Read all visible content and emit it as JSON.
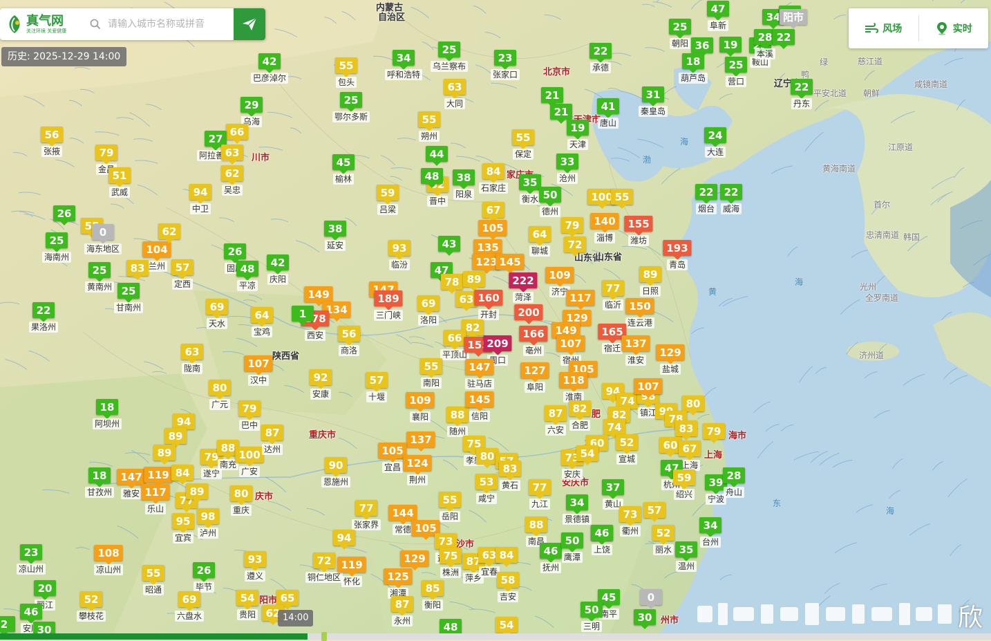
{
  "search": {
    "placeholder": "请输入城市名称或拼音"
  },
  "logo": {
    "brand": "真气网",
    "slogan": "关注环境 关爱健康"
  },
  "history": {
    "label": "历史: 2025-12-29 14:00"
  },
  "toolbar": {
    "wind_label": "风场",
    "realtime_label": "实时"
  },
  "timeline": {
    "current_label": "14:00",
    "progress": 0.31
  },
  "watermark": {
    "text": "欣"
  },
  "colors": {
    "good": "#3dbb1e",
    "moderate": "#e8c41c",
    "light": "#f5a017",
    "medium": "#ee5a3c",
    "heavy": "#c4245a",
    "none": "#b8b8b8",
    "brand": "#2e9a3c"
  },
  "map_labels": [
    {
      "text": "内蒙古",
      "kind": "province"
    },
    {
      "text": "自治区",
      "kind": "province"
    },
    {
      "text": "北京市",
      "kind": "city"
    },
    {
      "text": "天津市",
      "kind": "city"
    },
    {
      "text": "家庄市",
      "kind": "city"
    },
    {
      "text": "辽宁省",
      "kind": "province"
    },
    {
      "text": "山东省",
      "kind": "province"
    },
    {
      "text": "陕西省",
      "kind": "province"
    },
    {
      "text": "重庆市",
      "kind": "city"
    },
    {
      "text": "渤",
      "kind": "sea"
    },
    {
      "text": "海",
      "kind": "sea"
    },
    {
      "text": "黄",
      "kind": "sea"
    },
    {
      "text": "海",
      "kind": "sea"
    },
    {
      "text": "东",
      "kind": "sea"
    },
    {
      "text": "海",
      "kind": "sea"
    },
    {
      "text": "江原道",
      "kind": "foreign"
    },
    {
      "text": "黄海南道",
      "kind": "foreign"
    },
    {
      "text": "首尔",
      "kind": "foreign"
    },
    {
      "text": "忠清南道",
      "kind": "foreign"
    },
    {
      "text": "韩国",
      "kind": "foreign"
    },
    {
      "text": "光州",
      "kind": "foreign"
    },
    {
      "text": "全罗南道",
      "kind": "foreign"
    },
    {
      "text": "济州道",
      "kind": "foreign"
    },
    {
      "text": "慈江道",
      "kind": "foreign"
    },
    {
      "text": "咸镜南道",
      "kind": "foreign"
    },
    {
      "text": "平安北道",
      "kind": "foreign"
    },
    {
      "text": "朝鲜",
      "kind": "foreign"
    },
    {
      "text": "鸭",
      "kind": "foreign"
    },
    {
      "text": "绿",
      "kind": "foreign"
    },
    {
      "text": "安庆市",
      "kind": "city"
    },
    {
      "text": "上海",
      "kind": "city"
    },
    {
      "text": "海市",
      "kind": "city"
    },
    {
      "text": "川市",
      "kind": "city"
    },
    {
      "text": "庆市",
      "kind": "city"
    },
    {
      "text": "阳市",
      "kind": "city"
    },
    {
      "text": "沙市",
      "kind": "city"
    },
    {
      "text": "州市",
      "kind": "city"
    },
    {
      "text": "山东省",
      "kind": "province"
    },
    {
      "text": "肥",
      "kind": "city"
    }
  ],
  "stations": [
    {
      "v": "47",
      "c": "阜新"
    },
    {
      "v": "34",
      "c": ""
    },
    {
      "v": "41",
      "c": ""
    },
    {
      "v": "阳市",
      "c": ""
    },
    {
      "v": "25",
      "c": "朝阳"
    },
    {
      "v": "36",
      "c": ""
    },
    {
      "v": "19",
      "c": ""
    },
    {
      "v": "23",
      "c": "鞍山"
    },
    {
      "v": "28",
      "c": "本溪"
    },
    {
      "v": "22",
      "c": ""
    },
    {
      "v": "18",
      "c": "葫芦岛"
    },
    {
      "v": "25",
      "c": "营口"
    },
    {
      "v": "22",
      "c": "丹东"
    },
    {
      "v": "31",
      "c": "秦皇岛"
    },
    {
      "v": "24",
      "c": "大连"
    },
    {
      "v": "22",
      "c": "烟台"
    },
    {
      "v": "22",
      "c": "威海"
    },
    {
      "v": "22",
      "c": "承德"
    },
    {
      "v": "23",
      "c": "张家口"
    },
    {
      "v": "21",
      "c": ""
    },
    {
      "v": "21",
      "c": ""
    },
    {
      "v": "19",
      "c": "天津"
    },
    {
      "v": "41",
      "c": "唐山"
    },
    {
      "v": "55",
      "c": "保定"
    },
    {
      "v": "33",
      "c": "沧州"
    },
    {
      "v": "35",
      "c": "衡水"
    },
    {
      "v": "50",
      "c": "德州"
    },
    {
      "v": "84",
      "c": "石家庄"
    },
    {
      "v": "38",
      "c": "阳泉"
    },
    {
      "v": "52",
      "c": "晋中"
    },
    {
      "v": "48",
      "c": ""
    },
    {
      "v": "44",
      "c": ""
    },
    {
      "v": "55",
      "c": "朔州"
    },
    {
      "v": "63",
      "c": "大同"
    },
    {
      "v": "25",
      "c": "乌兰察布"
    },
    {
      "v": "34",
      "c": "呼和浩特"
    },
    {
      "v": "55",
      "c": "包头"
    },
    {
      "v": "42",
      "c": "巴彦淖尔"
    },
    {
      "v": "25",
      "c": "鄂尔多斯"
    },
    {
      "v": "45",
      "c": "榆林"
    },
    {
      "v": "29",
      "c": "乌海"
    },
    {
      "v": "66",
      "c": ""
    },
    {
      "v": "27",
      "c": "阿拉善盟"
    },
    {
      "v": "63",
      "c": ""
    },
    {
      "v": "62",
      "c": "吴忠"
    },
    {
      "v": "94",
      "c": "中卫"
    },
    {
      "v": "56",
      "c": "张掖"
    },
    {
      "v": "79",
      "c": "金昌"
    },
    {
      "v": "51",
      "c": "武威"
    },
    {
      "v": "26",
      "c": ""
    },
    {
      "v": "55",
      "c": ""
    },
    {
      "v": "0",
      "c": "海东地区"
    },
    {
      "v": "25",
      "c": "海南州"
    },
    {
      "v": "104",
      "c": "兰州"
    },
    {
      "v": "62",
      "c": ""
    },
    {
      "v": "83",
      "c": ""
    },
    {
      "v": "57",
      "c": "定西"
    },
    {
      "v": "25",
      "c": "黄南州"
    },
    {
      "v": "25",
      "c": "甘南州"
    },
    {
      "v": "26",
      "c": "固原"
    },
    {
      "v": "48",
      "c": "平凉"
    },
    {
      "v": "42",
      "c": "庆阳"
    },
    {
      "v": "22",
      "c": "果洛州"
    },
    {
      "v": "69",
      "c": "天水"
    },
    {
      "v": "64",
      "c": "宝鸡"
    },
    {
      "v": "38",
      "c": "延安"
    },
    {
      "v": "59",
      "c": "吕梁"
    },
    {
      "v": "93",
      "c": "临汾"
    },
    {
      "v": "43",
      "c": ""
    },
    {
      "v": "47",
      "c": ""
    },
    {
      "v": "67",
      "c": ""
    },
    {
      "v": "105",
      "c": ""
    },
    {
      "v": "135",
      "c": ""
    },
    {
      "v": "123",
      "c": ""
    },
    {
      "v": "145",
      "c": ""
    },
    {
      "v": "78",
      "c": ""
    },
    {
      "v": "89",
      "c": ""
    },
    {
      "v": "64",
      "c": "聊城"
    },
    {
      "v": "79",
      "c": ""
    },
    {
      "v": "72",
      "c": ""
    },
    {
      "v": "100",
      "c": ""
    },
    {
      "v": "55",
      "c": ""
    },
    {
      "v": "140",
      "c": "淄博"
    },
    {
      "v": "155",
      "c": "潍坊"
    },
    {
      "v": "193",
      "c": "青岛"
    },
    {
      "v": "222",
      "c": "菏泽"
    },
    {
      "v": "109",
      "c": "济宁"
    },
    {
      "v": "117",
      "c": ""
    },
    {
      "v": "77",
      "c": "临沂"
    },
    {
      "v": "89",
      "c": "日照"
    },
    {
      "v": "147",
      "c": ""
    },
    {
      "v": "189",
      "c": "三门峡"
    },
    {
      "v": "149",
      "c": ""
    },
    {
      "v": "134",
      "c": ""
    },
    {
      "v": "178",
      "c": "西安"
    },
    {
      "v": "56",
      "c": "商洛"
    },
    {
      "v": "69",
      "c": "洛阳"
    },
    {
      "v": "63",
      "c": ""
    },
    {
      "v": "160",
      "c": "开封"
    },
    {
      "v": "200",
      "c": ""
    },
    {
      "v": "129",
      "c": ""
    },
    {
      "v": "150",
      "c": "连云港"
    },
    {
      "v": "82",
      "c": ""
    },
    {
      "v": "66",
      "c": "平顶山"
    },
    {
      "v": "155",
      "c": ""
    },
    {
      "v": "209",
      "c": "周口"
    },
    {
      "v": "166",
      "c": "亳州"
    },
    {
      "v": "149",
      "c": ""
    },
    {
      "v": "107",
      "c": "宿州"
    },
    {
      "v": "165",
      "c": "宿迁"
    },
    {
      "v": "137",
      "c": "淮安"
    },
    {
      "v": "129",
      "c": "盐城"
    },
    {
      "v": "63",
      "c": "陇南"
    },
    {
      "v": "107",
      "c": "汉中"
    },
    {
      "v": "92",
      "c": "安康"
    },
    {
      "v": "57",
      "c": "十堰"
    },
    {
      "v": "55",
      "c": "南阳"
    },
    {
      "v": "147",
      "c": "驻马店"
    },
    {
      "v": "127",
      "c": "阜阳"
    },
    {
      "v": "105",
      "c": ""
    },
    {
      "v": "118",
      "c": "淮南"
    },
    {
      "v": "94",
      "c": ""
    },
    {
      "v": "74",
      "c": ""
    },
    {
      "v": "98",
      "c": "镇江"
    },
    {
      "v": "107",
      "c": ""
    },
    {
      "v": "80",
      "c": ""
    },
    {
      "v": "80",
      "c": "广元"
    },
    {
      "v": "79",
      "c": "巴中"
    },
    {
      "v": "109",
      "c": "襄阳"
    },
    {
      "v": "88",
      "c": "随州"
    },
    {
      "v": "145",
      "c": "信阳"
    },
    {
      "v": "87",
      "c": "六安"
    },
    {
      "v": "82",
      "c": "合肥"
    },
    {
      "v": "82",
      "c": ""
    },
    {
      "v": "74",
      "c": ""
    },
    {
      "v": "60",
      "c": ""
    },
    {
      "v": "52",
      "c": "宣城"
    },
    {
      "v": "99",
      "c": ""
    },
    {
      "v": "78",
      "c": ""
    },
    {
      "v": "83",
      "c": ""
    },
    {
      "v": "79",
      "c": ""
    },
    {
      "v": "60",
      "c": ""
    },
    {
      "v": "67",
      "c": "上海"
    },
    {
      "v": "18",
      "c": "阿坝州"
    },
    {
      "v": "94",
      "c": ""
    },
    {
      "v": "89",
      "c": ""
    },
    {
      "v": "89",
      "c": ""
    },
    {
      "v": "79",
      "c": "遂宁"
    },
    {
      "v": "88",
      "c": "南充"
    },
    {
      "v": "100",
      "c": "广安"
    },
    {
      "v": "87",
      "c": "达州"
    },
    {
      "v": "137",
      "c": ""
    },
    {
      "v": "105",
      "c": "宜昌"
    },
    {
      "v": "124",
      "c": "荆州"
    },
    {
      "v": "75",
      "c": "孝感"
    },
    {
      "v": "80",
      "c": ""
    },
    {
      "v": "57",
      "c": ""
    },
    {
      "v": "83",
      "c": "黄石"
    },
    {
      "v": "73",
      "c": "安庆"
    },
    {
      "v": "54",
      "c": ""
    },
    {
      "v": "18",
      "c": "甘孜州"
    },
    {
      "v": "147",
      "c": "雅安"
    },
    {
      "v": "119",
      "c": ""
    },
    {
      "v": "117",
      "c": "乐山"
    },
    {
      "v": "84",
      "c": ""
    },
    {
      "v": "77",
      "c": ""
    },
    {
      "v": "89",
      "c": ""
    },
    {
      "v": "95",
      "c": "宜宾"
    },
    {
      "v": "98",
      "c": "泸州"
    },
    {
      "v": "80",
      "c": "重庆"
    },
    {
      "v": "90",
      "c": "恩施州"
    },
    {
      "v": "53",
      "c": "咸宁"
    },
    {
      "v": "77",
      "c": "九江"
    },
    {
      "v": "34",
      "c": "景德镇"
    },
    {
      "v": "37",
      "c": "黄山"
    },
    {
      "v": "47",
      "c": "杭州"
    },
    {
      "v": "59",
      "c": "绍兴"
    },
    {
      "v": "39",
      "c": "宁波"
    },
    {
      "v": "28",
      "c": "舟山"
    },
    {
      "v": "77",
      "c": "张家界"
    },
    {
      "v": "144",
      "c": "常德"
    },
    {
      "v": "55",
      "c": "岳阳"
    },
    {
      "v": "105",
      "c": ""
    },
    {
      "v": "88",
      "c": "南昌"
    },
    {
      "v": "73",
      "c": "衢州"
    },
    {
      "v": "57",
      "c": ""
    },
    {
      "v": "46",
      "c": ""
    },
    {
      "v": "52",
      "c": "丽水"
    },
    {
      "v": "34",
      "c": "台州"
    },
    {
      "v": "23",
      "c": "凉山州"
    },
    {
      "v": "108",
      "c": "凉山州"
    },
    {
      "v": "55",
      "c": "昭通"
    },
    {
      "v": "26",
      "c": "毕节"
    },
    {
      "v": "93",
      "c": "遵义"
    },
    {
      "v": "94",
      "c": ""
    },
    {
      "v": "72",
      "c": "铜仁地区"
    },
    {
      "v": "119",
      "c": "怀化"
    },
    {
      "v": "129",
      "c": ""
    },
    {
      "v": "73",
      "c": "益阳"
    },
    {
      "v": "75",
      "c": "株洲"
    },
    {
      "v": "87",
      "c": "萍乡"
    },
    {
      "v": "63",
      "c": "宜春"
    },
    {
      "v": "84",
      "c": ""
    },
    {
      "v": "46",
      "c": "抚州"
    },
    {
      "v": "50",
      "c": "鹰潭"
    },
    {
      "v": "46",
      "c": "上饶"
    },
    {
      "v": "35",
      "c": "温州"
    },
    {
      "v": "20",
      "c": "丽江"
    },
    {
      "v": "52",
      "c": "攀枝花"
    },
    {
      "v": "69",
      "c": "六盘水"
    },
    {
      "v": "54",
      "c": "贵阳"
    },
    {
      "v": "65",
      "c": ""
    },
    {
      "v": "125",
      "c": "湘潭"
    },
    {
      "v": "85",
      "c": "衡阳"
    },
    {
      "v": "58",
      "c": "吉安"
    },
    {
      "v": "87",
      "c": "永州"
    },
    {
      "v": "46",
      "c": "安顺"
    },
    {
      "v": "62",
      "c": ""
    },
    {
      "v": "30",
      "c": ""
    },
    {
      "v": "48",
      "c": ""
    },
    {
      "v": "54",
      "c": ""
    },
    {
      "v": "45",
      "c": "南平"
    },
    {
      "v": "50",
      "c": "三明"
    },
    {
      "v": "30",
      "c": ""
    },
    {
      "v": "0",
      "c": ""
    },
    {
      "v": "2",
      "c": ""
    },
    {
      "v": "1",
      "c": ""
    }
  ]
}
